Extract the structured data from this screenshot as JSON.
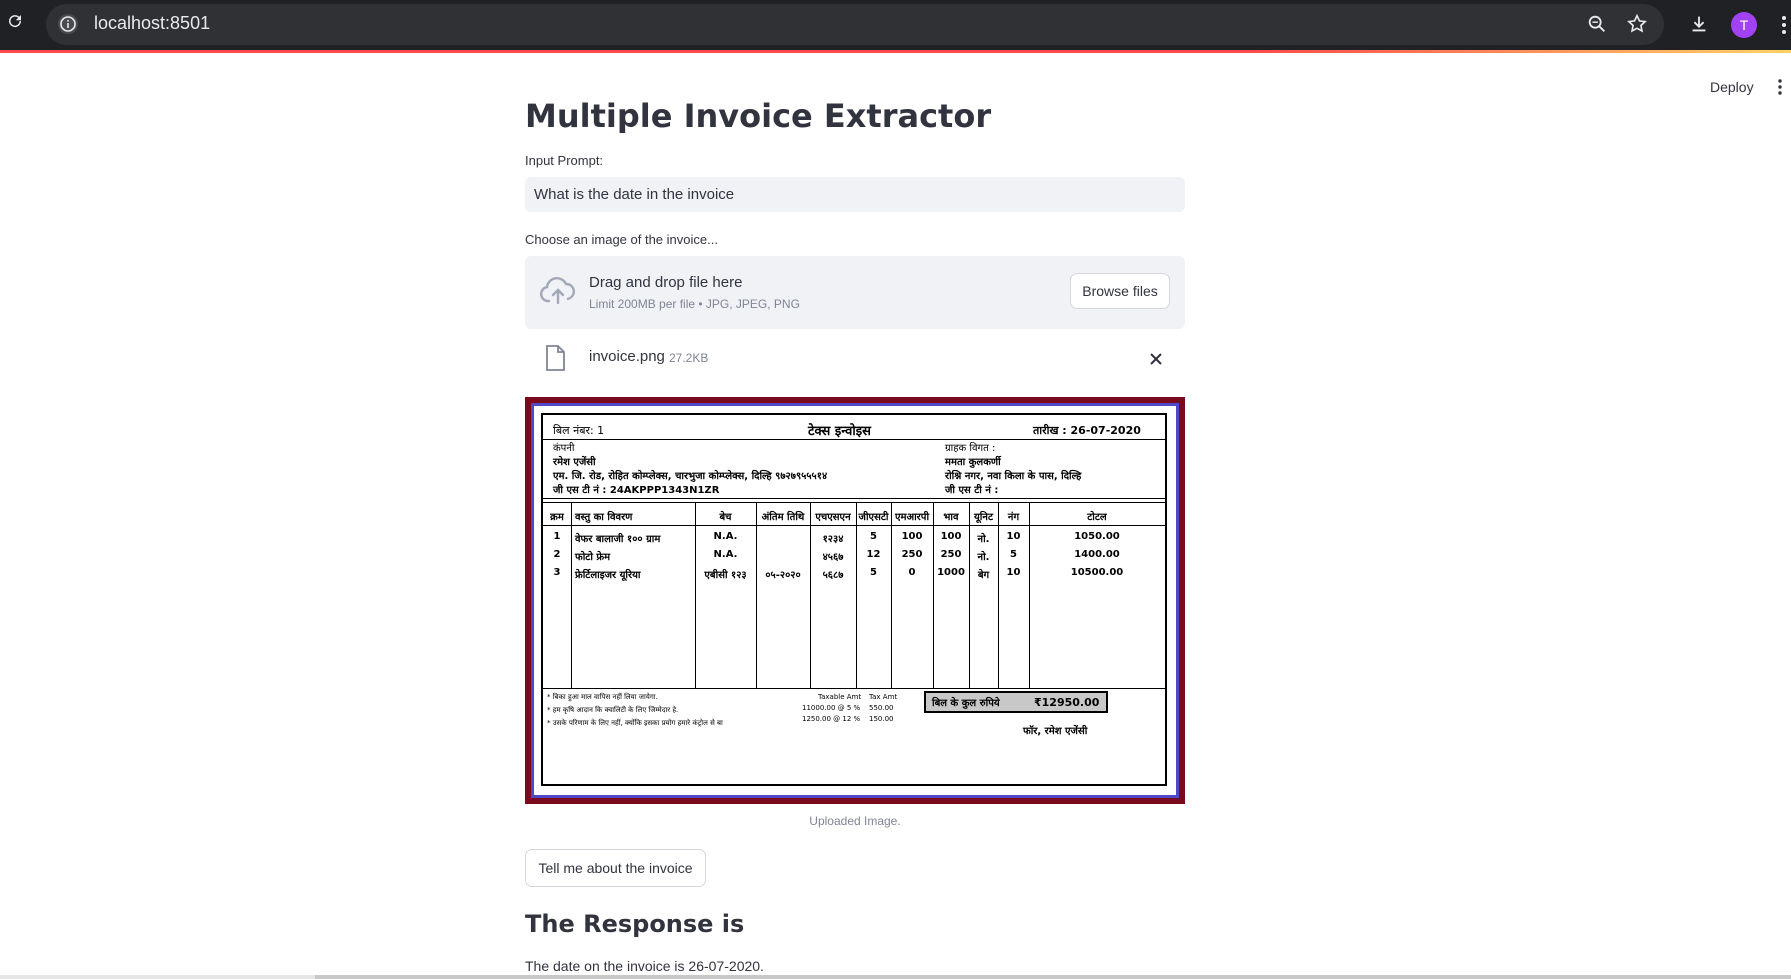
{
  "browser": {
    "url": "localhost:8501",
    "avatar_letter": "T",
    "accent": "#a142f4"
  },
  "header": {
    "deploy_label": "Deploy"
  },
  "main": {
    "title": "Multiple Invoice Extractor",
    "prompt_label": "Input Prompt:",
    "prompt_value": "What is the date in the invoice",
    "uploader_label": "Choose an image of the invoice...",
    "drop_title": "Drag and drop file here",
    "drop_limits": "Limit 200MB per file • JPG, JPEG, PNG",
    "browse_label": "Browse files",
    "file_name": "invoice.png",
    "file_size": "27.2KB",
    "image_caption": "Uploaded Image.",
    "submit_label": "Tell me about the invoice",
    "response_heading": "The Response is",
    "response_text": "The date on the invoice is 26-07-2020."
  },
  "invoice": {
    "bill_no": "बिल नंबर: 1",
    "doc_title": "टेक्स इन्वोइस",
    "date": "तारीख : 26-07-2020",
    "company_label": "कंपनी",
    "company_name": "रमेश एजेंसी",
    "company_address": "एम. जि. रोड, रोहित कोम्प्लेक्स, चारभुजा कोम्प्लेक्स, दिल्हि ९७२७९५५५१४",
    "company_gst": "जी एस टी नं : 24AKPPP1343N1ZR",
    "customer_label": "ग्राहक विगत :",
    "customer_name": "ममता कुलकर्णी",
    "customer_address": "रोश्नि नगर, नवा किला के पास, दिल्हि",
    "customer_gst": "जी एस टी नं :",
    "columns": [
      "क्रम",
      "वस्तु का विवरण",
      "बेच",
      "अंतिम तिथि",
      "एचएसएन",
      "जीएसटी",
      "एमआरपी",
      "भाव",
      "यूनिट",
      "नंग",
      "टोटल"
    ],
    "rows": [
      [
        "1",
        "वेफर बालाजी १०० ग्राम",
        "N.A.",
        "",
        "१२३४",
        "5",
        "100",
        "100",
        "नो.",
        "10",
        "1050.00"
      ],
      [
        "2",
        "फोटो फ्रेम",
        "N.A.",
        "",
        "४५६७",
        "12",
        "250",
        "250",
        "नो.",
        "5",
        "1400.00"
      ],
      [
        "3",
        "फ्रेर्टिलाइजर यूरिया",
        "एबीसी १२३",
        "०५-२०२०",
        "५६८७",
        "5",
        "0",
        "1000",
        "बेग",
        "10",
        "10500.00"
      ]
    ],
    "notes": [
      "* बिका हुआ माल वापिस नहीं लिया जायेगा.",
      "* हम कृषि आदान कि क्वालिटी के लिए जिम्मेदार हे.",
      "* उसके परिणाम के लिए नहीं, क्योंकि इसका प्रयोग हमारे कंट्रोल से बा"
    ],
    "tax_headers": [
      "Taxable Amt",
      "Tax Amt"
    ],
    "tax_rows": [
      [
        "11000.00 @ 5 %",
        "550.00"
      ],
      [
        "1250.00 @ 12 %",
        "150.00"
      ]
    ],
    "total_label": "बिल के कुल रुपिये",
    "total_value": "₹12950.00",
    "signature": "फॉर, रमेश एजेंसी"
  }
}
